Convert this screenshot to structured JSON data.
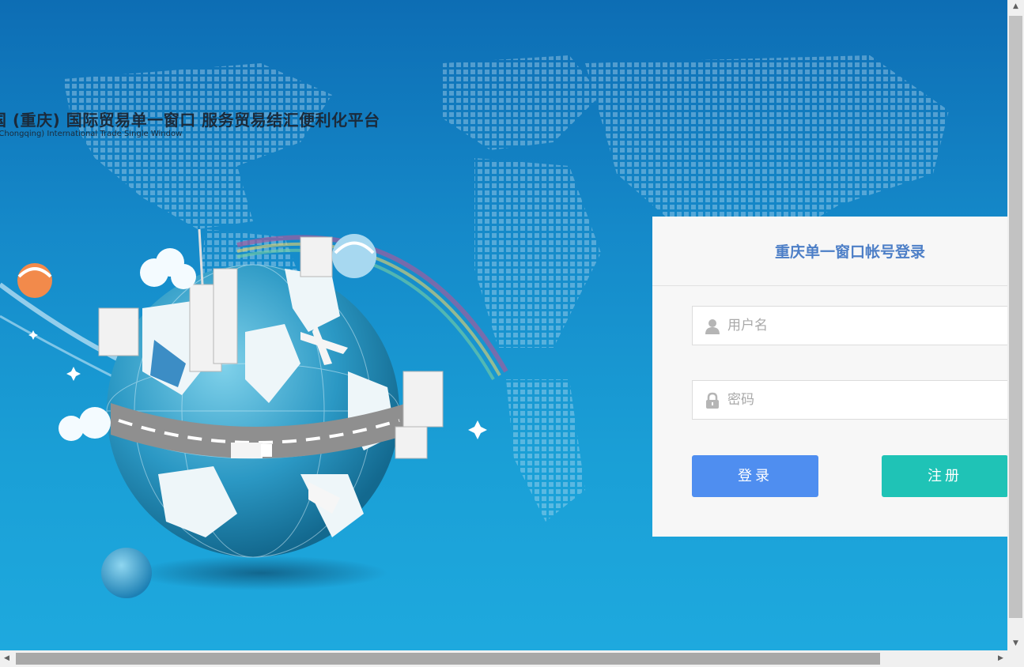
{
  "header": {
    "title_cn": "国 (重庆) 国际贸易单一窗口  服务贸易结汇便利化平台",
    "title_en": "na(Chongqing) International Trade Single Window"
  },
  "login": {
    "title": "重庆单一窗口帐号登录",
    "username_placeholder": "用户名",
    "password_placeholder": "密码",
    "login_label": "登录",
    "register_label": "注册"
  },
  "icons": {
    "user": "user-icon",
    "lock": "lock-icon"
  },
  "colors": {
    "title": "#4d7fc7",
    "login_button": "#4f8ef0",
    "register_button": "#1fc3b6",
    "background_top": "#0d6db4",
    "background_bottom": "#1ea9de"
  }
}
